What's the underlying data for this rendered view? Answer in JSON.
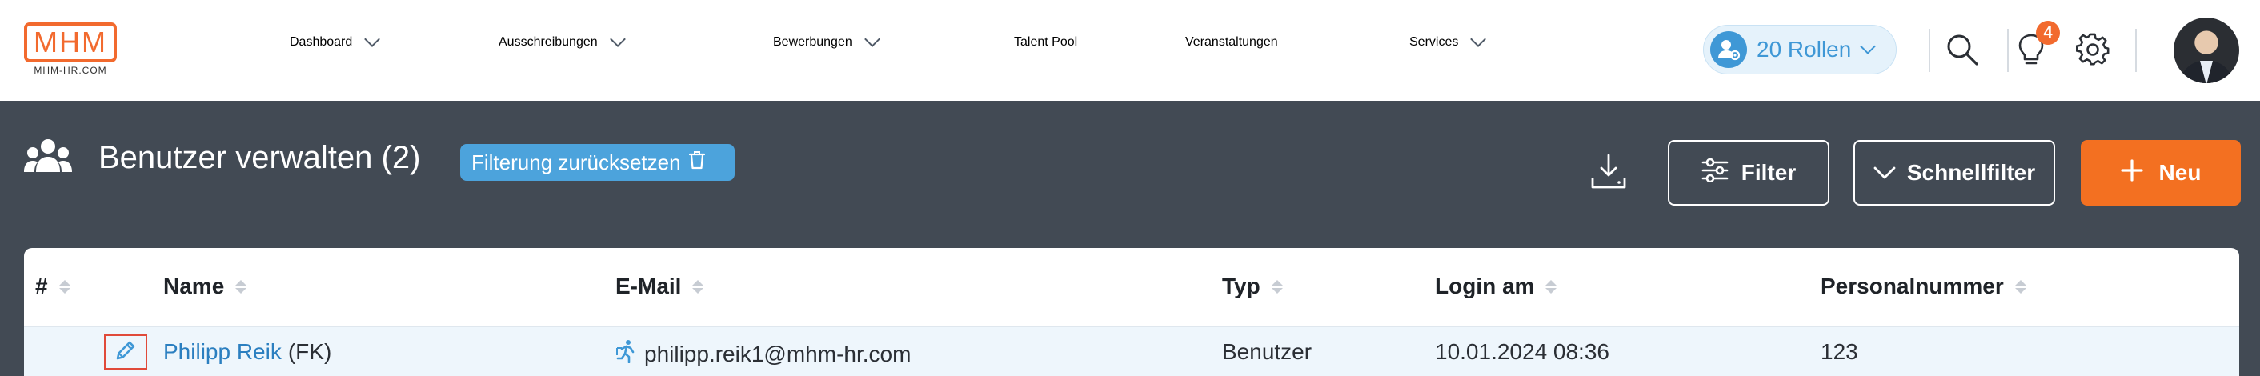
{
  "logo": {
    "text": "MHM",
    "subtext": "MHM-HR.COM"
  },
  "nav": [
    {
      "label": "Dashboard",
      "has_dropdown": true
    },
    {
      "label": "Ausschreibungen",
      "has_dropdown": true
    },
    {
      "label": "Bewerbungen",
      "has_dropdown": true
    },
    {
      "label": "Talent Pool",
      "has_dropdown": false
    },
    {
      "label": "Veranstaltungen",
      "has_dropdown": false
    },
    {
      "label": "Services",
      "has_dropdown": true
    }
  ],
  "roles": {
    "label": "20 Rollen"
  },
  "notifications": {
    "count": "4"
  },
  "icons": {
    "search": "search-icon",
    "notifications": "lightbulb-icon",
    "settings": "gear-icon",
    "users": "users-icon",
    "download": "download-icon",
    "filter": "sliders-icon",
    "trash": "trash-icon",
    "edit": "pencil-icon",
    "user_type": "running-person-icon"
  },
  "page": {
    "title": "Benutzer verwalten (2)",
    "reset_filter_label": "Filterung zurücksetzen",
    "filter_label": "Filter",
    "quickfilter_label": "Schnellfilter",
    "new_label": "Neu"
  },
  "table": {
    "columns": [
      "#",
      "Name",
      "E-Mail",
      "Typ",
      "Login am",
      "Personalnummer"
    ],
    "rows": [
      {
        "name": "Philipp Reik",
        "role_suffix": "(FK)",
        "email": "philipp.reik1@mhm-hr.com",
        "type": "Benutzer",
        "login": "10.01.2024 08:36",
        "personnel_number": "123"
      }
    ]
  },
  "colors": {
    "accent_orange": "#f37021",
    "accent_blue": "#3f98d6",
    "header_dark": "#424a54",
    "row_highlight": "#eef6fc"
  }
}
